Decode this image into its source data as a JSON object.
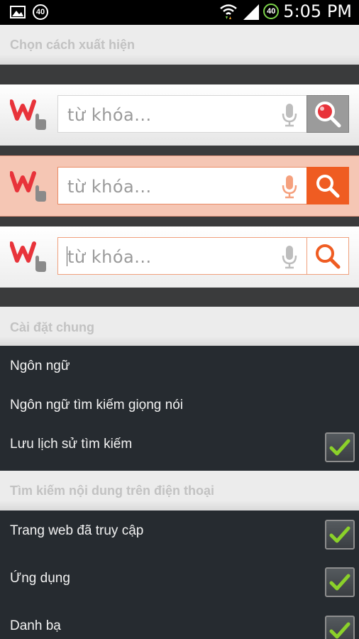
{
  "status_bar": {
    "time": "5:05 PM",
    "badge_left": "40",
    "badge_right": "40",
    "icons": [
      "image-icon",
      "wifi-icon",
      "signal-icon"
    ]
  },
  "sections": {
    "appearance": "Chọn cách xuất hiện",
    "general": "Cài đặt chung",
    "phone_search": "Tìm kiếm nội dung trên điện thoại"
  },
  "search_themes": [
    {
      "placeholder": "từ khóa...",
      "style": "gray",
      "button_color": "#9b9b9b",
      "icon_color": "#e8333a"
    },
    {
      "placeholder": "từ khóa...",
      "style": "orange",
      "button_color": "#ef5c22",
      "icon_color": "#ffffff"
    },
    {
      "placeholder": "từ khóa...",
      "style": "white",
      "button_color": "#ffffff",
      "icon_color": "#ef5c22"
    }
  ],
  "general_settings": [
    {
      "label": "Ngôn ngữ",
      "has_checkbox": false
    },
    {
      "label": "Ngôn ngữ tìm kiếm giọng nói",
      "has_checkbox": false
    },
    {
      "label": "Lưu lịch sử tìm kiếm",
      "has_checkbox": true,
      "checked": true
    }
  ],
  "phone_settings": [
    {
      "label": "Trang web đã truy cập",
      "checked": true
    },
    {
      "label": "Ứng dụng",
      "checked": true
    },
    {
      "label": "Danh bạ",
      "checked": true
    }
  ],
  "colors": {
    "accent_orange": "#ef5c22",
    "logo_red": "#e8333a",
    "check_green": "#8bd12a"
  }
}
